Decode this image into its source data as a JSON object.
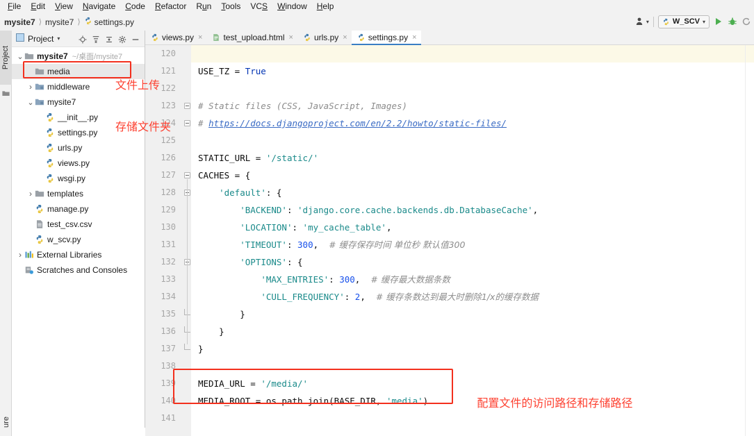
{
  "menu": {
    "items": [
      {
        "label": "File",
        "mnemonic": "F"
      },
      {
        "label": "Edit",
        "mnemonic": "E"
      },
      {
        "label": "View",
        "mnemonic": "V"
      },
      {
        "label": "Navigate",
        "mnemonic": "N"
      },
      {
        "label": "Code",
        "mnemonic": "C"
      },
      {
        "label": "Refactor",
        "mnemonic": "R"
      },
      {
        "label": "Run",
        "mnemonic": "u"
      },
      {
        "label": "Tools",
        "mnemonic": "T"
      },
      {
        "label": "VCS",
        "mnemonic": "S"
      },
      {
        "label": "Window",
        "mnemonic": "W"
      },
      {
        "label": "Help",
        "mnemonic": "H"
      }
    ]
  },
  "breadcrumb": {
    "items": [
      "mysite7",
      "mysite7",
      "settings.py"
    ],
    "file_icon": "python-file-icon"
  },
  "toolbar": {
    "profile_icon": "user-profile-icon",
    "run_config": "W_SCV",
    "run_icon": "run-play-icon",
    "debug_icon": "debug-bug-icon",
    "coverage_icon": "run-coverage-icon"
  },
  "left_strip": {
    "project_tab": "Project",
    "bottom_tab": "ure"
  },
  "project_panel": {
    "title": "Project",
    "tools": [
      "locate-target-icon",
      "expand-all-icon",
      "collapse-all-icon",
      "settings-gear-icon",
      "hide-panel-icon"
    ],
    "tree": [
      {
        "label": "mysite7",
        "path": "~/桌面/mysite7",
        "icon": "folder-icon",
        "arrow": "expanded",
        "indent": 0,
        "bold": true,
        "selected": false
      },
      {
        "label": "media",
        "path": "",
        "icon": "folder-icon",
        "arrow": "none",
        "indent": 1,
        "bold": false,
        "selected": true
      },
      {
        "label": "middleware",
        "path": "",
        "icon": "module-folder-icon",
        "arrow": "collapsed",
        "indent": 1,
        "bold": false,
        "selected": false
      },
      {
        "label": "mysite7",
        "path": "",
        "icon": "module-folder-icon",
        "arrow": "expanded",
        "indent": 1,
        "bold": false,
        "selected": false
      },
      {
        "label": "__init__.py",
        "path": "",
        "icon": "python-file-icon",
        "arrow": "none",
        "indent": 2,
        "bold": false,
        "selected": false
      },
      {
        "label": "settings.py",
        "path": "",
        "icon": "python-file-icon",
        "arrow": "none",
        "indent": 2,
        "bold": false,
        "selected": false
      },
      {
        "label": "urls.py",
        "path": "",
        "icon": "python-file-icon",
        "arrow": "none",
        "indent": 2,
        "bold": false,
        "selected": false
      },
      {
        "label": "views.py",
        "path": "",
        "icon": "python-file-icon",
        "arrow": "none",
        "indent": 2,
        "bold": false,
        "selected": false
      },
      {
        "label": "wsgi.py",
        "path": "",
        "icon": "python-file-icon",
        "arrow": "none",
        "indent": 2,
        "bold": false,
        "selected": false
      },
      {
        "label": "templates",
        "path": "",
        "icon": "folder-icon",
        "arrow": "collapsed",
        "indent": 1,
        "bold": false,
        "selected": false
      },
      {
        "label": "manage.py",
        "path": "",
        "icon": "python-file-icon",
        "arrow": "none",
        "indent": 1,
        "bold": false,
        "selected": false
      },
      {
        "label": "test_csv.csv",
        "path": "",
        "icon": "csv-file-icon",
        "arrow": "none",
        "indent": 1,
        "bold": false,
        "selected": false
      },
      {
        "label": "w_scv.py",
        "path": "",
        "icon": "python-file-icon",
        "arrow": "none",
        "indent": 1,
        "bold": false,
        "selected": false
      },
      {
        "label": "External Libraries",
        "path": "",
        "icon": "libraries-icon",
        "arrow": "collapsed",
        "indent": 0,
        "bold": false,
        "selected": false
      },
      {
        "label": "Scratches and Consoles",
        "path": "",
        "icon": "scratches-icon",
        "arrow": "none",
        "indent": 0,
        "bold": false,
        "selected": false
      }
    ]
  },
  "editor": {
    "tabs": [
      {
        "label": "views.py",
        "icon": "python-file-icon",
        "active": false
      },
      {
        "label": "test_upload.html",
        "icon": "html-file-icon",
        "active": false
      },
      {
        "label": "urls.py",
        "icon": "python-file-icon",
        "active": false
      },
      {
        "label": "settings.py",
        "icon": "python-file-icon",
        "active": true
      }
    ],
    "first_line_number": 120,
    "lines": [
      {
        "n": 120,
        "text": "",
        "highlight": true
      },
      {
        "n": 121,
        "text": "USE_TZ = True"
      },
      {
        "n": 122,
        "text": ""
      },
      {
        "n": 123,
        "text": "# Static files (CSS, JavaScript, Images)"
      },
      {
        "n": 124,
        "text": "# https://docs.djangoproject.com/en/2.2/howto/static-files/"
      },
      {
        "n": 125,
        "text": ""
      },
      {
        "n": 126,
        "text": "STATIC_URL = '/static/'"
      },
      {
        "n": 127,
        "text": "CACHES = {"
      },
      {
        "n": 128,
        "text": "    'default': {"
      },
      {
        "n": 129,
        "text": "        'BACKEND': 'django.core.cache.backends.db.DatabaseCache',"
      },
      {
        "n": 130,
        "text": "        'LOCATION': 'my_cache_table',"
      },
      {
        "n": 131,
        "text": "        'TIMEOUT': 300,  # 缓存保存时间 单位秒 默认值300"
      },
      {
        "n": 132,
        "text": "        'OPTIONS': {"
      },
      {
        "n": 133,
        "text": "            'MAX_ENTRIES': 300,  # 缓存最大数据条数"
      },
      {
        "n": 134,
        "text": "            'CULL_FREQUENCY': 2,  # 缓存条数达到最大时删除1/x的缓存数据"
      },
      {
        "n": 135,
        "text": "        }"
      },
      {
        "n": 136,
        "text": "    }"
      },
      {
        "n": 137,
        "text": "}"
      },
      {
        "n": 138,
        "text": ""
      },
      {
        "n": 139,
        "text": "MEDIA_URL = '/media/'"
      },
      {
        "n": 140,
        "text": "MEDIA_ROOT = os.path.join(BASE_DIR, 'media')"
      },
      {
        "n": 141,
        "text": ""
      }
    ]
  },
  "annotations": {
    "media_note_line1": "文件上传",
    "media_note_line2": "存储文件夹",
    "media_path_note": "配置文件的访问路径和存储路径",
    "color": "#fd4030"
  }
}
